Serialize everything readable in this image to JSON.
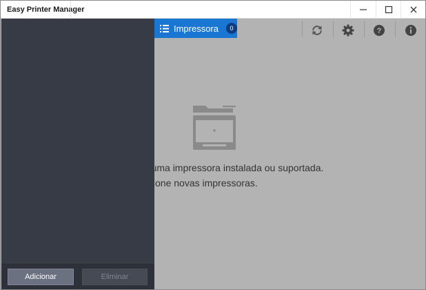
{
  "window": {
    "title": "Easy Printer Manager"
  },
  "tab": {
    "label": "Impressora",
    "count": "0"
  },
  "toolbar": {
    "icons": [
      "refresh-icon",
      "settings-icon",
      "help-icon",
      "info-icon"
    ]
  },
  "empty_state": {
    "line1": "nhuma impressora instalada ou suportada.",
    "line2": "dicione novas impressoras."
  },
  "sidebar": {
    "add_label": "Adicionar",
    "delete_label": "Eliminar"
  },
  "colors": {
    "accent": "#1976d2",
    "sidebar": "#373b46",
    "content_bg": "#b3b3b3"
  }
}
